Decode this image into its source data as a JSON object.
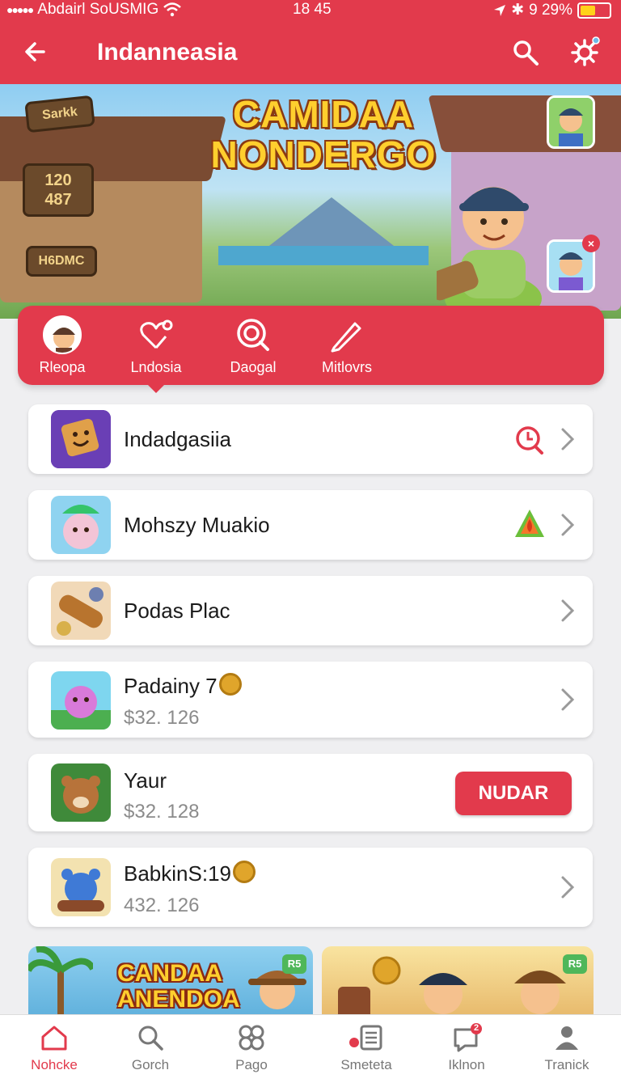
{
  "status_bar": {
    "carrier": "Abdairl SoUSMIG",
    "time": "18 45",
    "battery": "9 29%"
  },
  "app_bar": {
    "title": "Indanneasia"
  },
  "banner": {
    "title_line1": "CAMIDAA",
    "title_line2": "NONDERGO",
    "sign_top": "Sarkk",
    "stat1": "120",
    "stat2": "487",
    "sign_bottom": "H6DMC"
  },
  "categories": [
    {
      "label": "Rleopa",
      "icon": "avatar"
    },
    {
      "label": "Lndosia",
      "icon": "heart-icon"
    },
    {
      "label": "Daogal",
      "icon": "target-icon"
    },
    {
      "label": "Mitlovrs",
      "icon": "pencil-icon"
    }
  ],
  "list": [
    {
      "name": "Indadgasiia",
      "action_icon": "search-icon"
    },
    {
      "name": "Mohszy Muakio",
      "action_icon": "alert-icon"
    },
    {
      "name": "Podas Plac"
    },
    {
      "name": "Padainy 7",
      "price": "$32. 126"
    },
    {
      "name": "Yaur",
      "price": "$32. 128",
      "button": "NUDAR"
    },
    {
      "name": "BabkinS:19",
      "price": "432. 126"
    }
  ],
  "promos": [
    {
      "text_line1": "CANDAA",
      "text_line2": "ANENDOA",
      "tag": "R5"
    },
    {
      "tag": "R5"
    }
  ],
  "tabs": [
    {
      "label": "Nohcke",
      "icon": "home-icon",
      "active": true
    },
    {
      "label": "Gorch",
      "icon": "search-icon"
    },
    {
      "label": "Pago",
      "icon": "grid-icon"
    },
    {
      "label": "Smeteta",
      "icon": "list-icon"
    },
    {
      "label": "Iklnon",
      "icon": "bell-icon",
      "badge": "2"
    },
    {
      "label": "Tranick",
      "icon": "person-icon"
    }
  ],
  "colors": {
    "accent": "#e23a4c",
    "background": "#efeff1",
    "coin": "#e0a52b"
  }
}
